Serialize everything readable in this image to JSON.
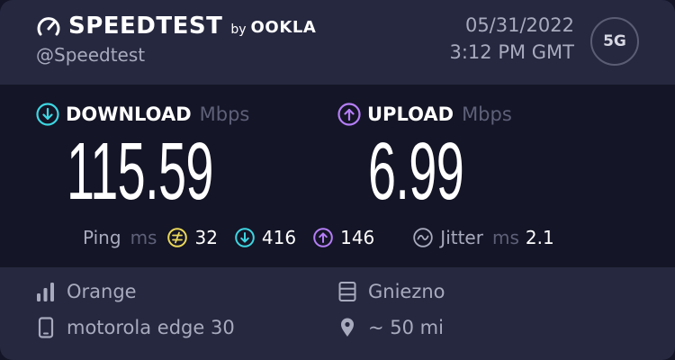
{
  "header": {
    "brand": "SPEEDTEST",
    "by": "by",
    "partner": "OOKLA",
    "handle": "@Speedtest",
    "date": "05/31/2022",
    "time": "3:12 PM GMT",
    "network_badge": "5G"
  },
  "download": {
    "label": "DOWNLOAD",
    "unit": "Mbps",
    "value": "115.59",
    "icon": "download-arrow-icon",
    "color": "#3dd6e2"
  },
  "upload": {
    "label": "UPLOAD",
    "unit": "Mbps",
    "value": "6.99",
    "icon": "upload-arrow-icon",
    "color": "#b57ef7"
  },
  "ping": {
    "label": "Ping",
    "unit": "ms",
    "idle": "32",
    "download": "416",
    "upload": "146",
    "idle_color": "#ebd85a"
  },
  "jitter": {
    "label": "Jitter",
    "unit": "ms",
    "value": "2.1"
  },
  "provider": {
    "name": "Orange",
    "icon": "signal-bars-icon"
  },
  "server": {
    "name": "Gniezno",
    "icon": "server-icon"
  },
  "device": {
    "name": "motorola edge 30",
    "icon": "phone-icon"
  },
  "distance": {
    "text": "~ 50 mi",
    "icon": "location-pin-icon"
  }
}
